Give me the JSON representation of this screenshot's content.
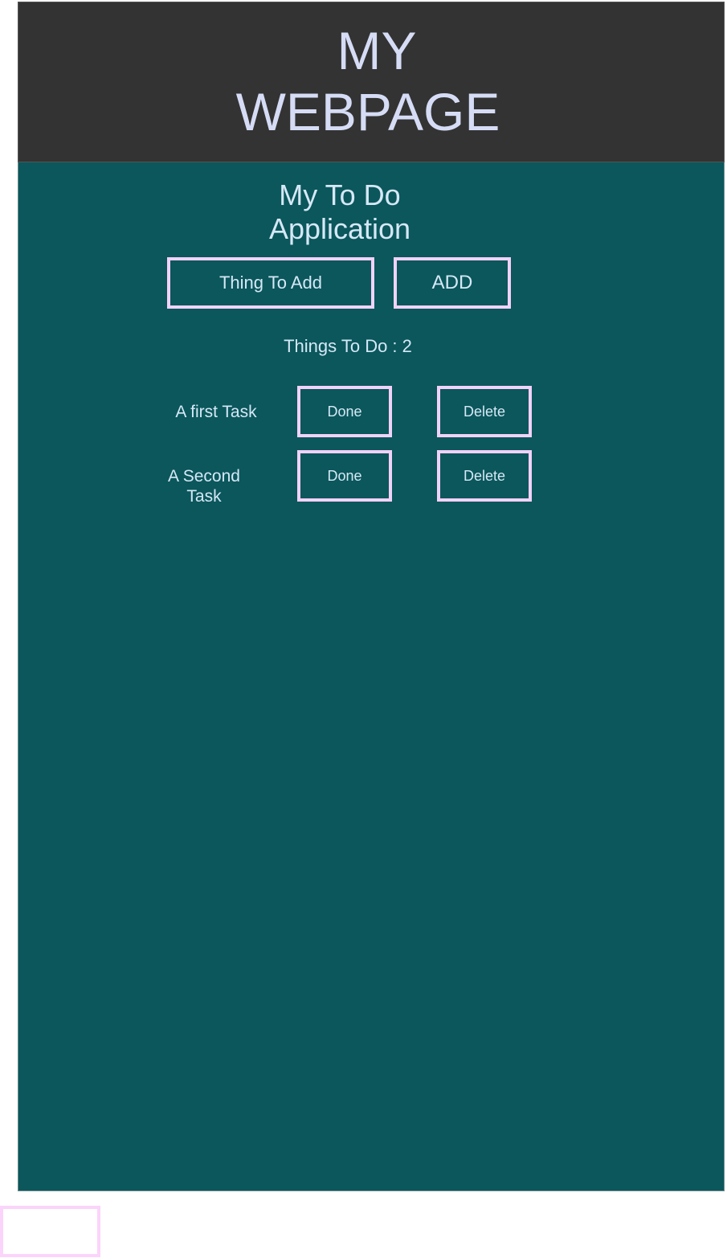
{
  "header": {
    "title_line1": "MY",
    "title_line2": "WEBPAGE"
  },
  "app": {
    "title_line1": "My To Do",
    "title_line2": "Application",
    "input_placeholder": "Thing To Add",
    "add_label": "ADD",
    "count_label": "Things To Do : ",
    "count_value": "2",
    "tasks": [
      {
        "label": "A first Task",
        "done_label": "Done",
        "delete_label": "Delete"
      },
      {
        "label": "A Second Task",
        "done_label": "Done",
        "delete_label": "Delete"
      }
    ]
  },
  "colors": {
    "header_bg": "#333333",
    "main_bg": "#0b575b",
    "button_border": "#f2d2f8",
    "text": "#d6e8f7"
  }
}
